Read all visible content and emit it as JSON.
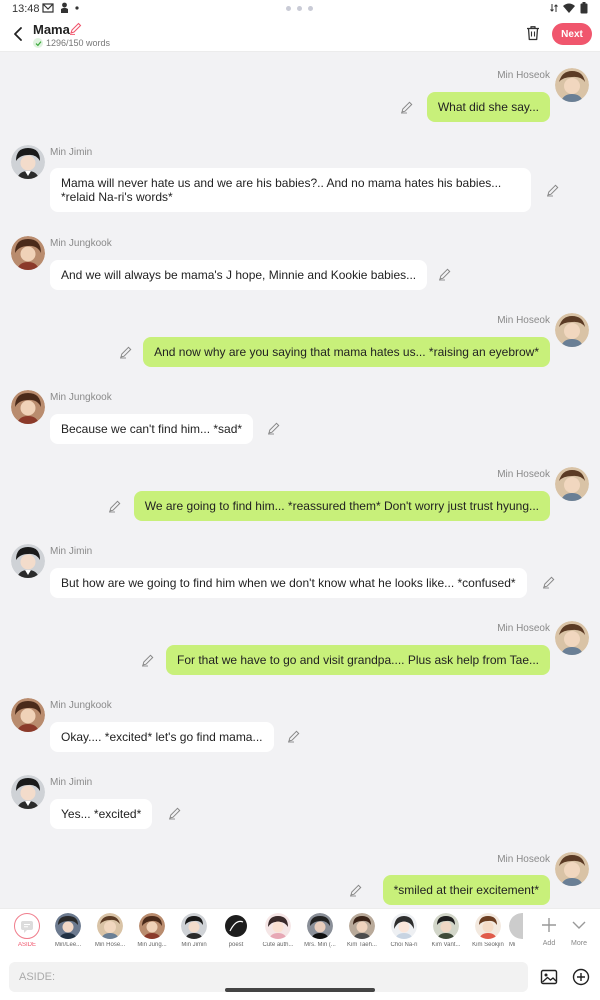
{
  "status_bar": {
    "time": "13:48"
  },
  "header": {
    "title": "Mama",
    "word_count": "1296/150 words",
    "next_label": "Next"
  },
  "messages": [
    {
      "side": "out",
      "sender": "Min Hoseok",
      "text": "What did she say...",
      "avatar": "hoseok"
    },
    {
      "side": "in",
      "sender": "Min Jimin",
      "text": "Mama will never hate us and we are his babies?.. And no mama hates his babies... *relaid Na-ri's words*",
      "avatar": "jimin"
    },
    {
      "side": "in",
      "sender": "Min Jungkook",
      "text": "And we will always be mama's J hope, Minnie and Kookie babies...",
      "avatar": "jungkook"
    },
    {
      "side": "out",
      "sender": "Min Hoseok",
      "text": "And now why are you saying that mama hates us... *raising an eyebrow*",
      "avatar": "hoseok"
    },
    {
      "side": "in",
      "sender": "Min Jungkook",
      "text": "Because we can't find him... *sad*",
      "avatar": "jungkook"
    },
    {
      "side": "out",
      "sender": "Min Hoseok",
      "text": "We are going to find him... *reassured them* Don't worry just trust hyung...",
      "avatar": "hoseok"
    },
    {
      "side": "in",
      "sender": "Min Jimin",
      "text": "But how are we going to find him when we don't know what he looks like... *confused*",
      "avatar": "jimin"
    },
    {
      "side": "out",
      "sender": "Min Hoseok",
      "text": "For that we have to go and visit grandpa.... Plus ask help from Tae...",
      "avatar": "hoseok"
    },
    {
      "side": "in",
      "sender": "Min Jungkook",
      "text": "Okay.... *excited* let's go find mama...",
      "avatar": "jungkook"
    },
    {
      "side": "in",
      "sender": "Min Jimin",
      "text": "Yes... *excited*",
      "avatar": "jimin"
    },
    {
      "side": "out",
      "sender": "Min Hoseok",
      "text": "*smiled at their excitement*",
      "avatar": "hoseok"
    }
  ],
  "characters": [
    {
      "name": "ASIDE"
    },
    {
      "name": "Min/Lee..."
    },
    {
      "name": "Min Hose..."
    },
    {
      "name": "Min Jung..."
    },
    {
      "name": "Min Jimin"
    },
    {
      "name": "poest"
    },
    {
      "name": "Cute auth..."
    },
    {
      "name": "Mrs. Min (..."
    },
    {
      "name": "Kim Taeh..."
    },
    {
      "name": "Choi Na-ri"
    },
    {
      "name": "Kim Vant..."
    },
    {
      "name": "Kim Seokjin"
    },
    {
      "name": "Mi"
    }
  ],
  "tools": {
    "add_label": "Add",
    "more_label": "More"
  },
  "input": {
    "placeholder": "ASIDE:"
  },
  "colors": {
    "accent": "#f0566d",
    "outgoing_bubble": "#c8f07a",
    "incoming_bubble": "#ffffff",
    "background": "#f2f2f4"
  },
  "icons": [
    "back-arrow-icon",
    "pencil-icon",
    "check-icon",
    "trash-icon",
    "edit-icon",
    "chat-bubble-icon",
    "plus-icon",
    "chevron-down-icon",
    "image-icon",
    "circle-plus-icon"
  ]
}
